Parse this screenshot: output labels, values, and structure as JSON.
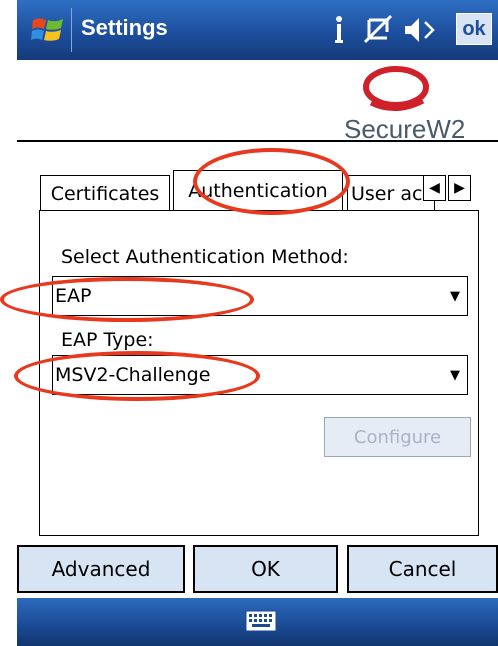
{
  "titlebar": {
    "title": "Settings",
    "ok_label": "ok"
  },
  "logo": {
    "text": "SecureW2"
  },
  "tabs": [
    {
      "label": "Certificates"
    },
    {
      "label": "Authentication"
    },
    {
      "label": "User ac"
    }
  ],
  "form": {
    "auth_method_label": "Select Authentication Method:",
    "auth_method_value": "EAP",
    "eap_type_label": "EAP Type:",
    "eap_type_value": "MSV2-Challenge",
    "configure_label": "Configure"
  },
  "buttons": {
    "advanced": "Advanced",
    "ok": "OK",
    "cancel": "Cancel"
  },
  "colors": {
    "titlebar": "#1d4f9d",
    "button_face": "#d7e4f3",
    "annotation": "#e8391e",
    "logo_red": "#d0202a"
  }
}
